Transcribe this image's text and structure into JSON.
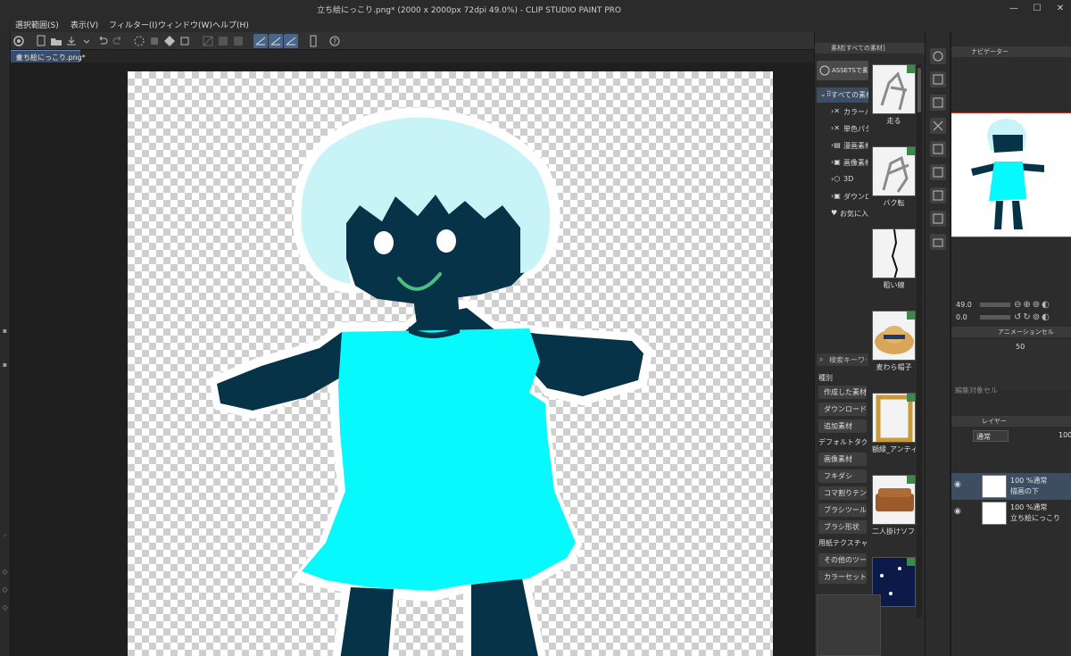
{
  "window": {
    "title": "立ち絵にっこり.png* (2000 x 2000px 72dpi 49.0%)  - CLIP STUDIO PAINT PRO",
    "minimize": "—",
    "maximize": "☐",
    "close": "✕"
  },
  "menu": [
    "選択範囲(S)",
    "表示(V)",
    "フィルター(I)",
    "ウィンドウ(W)",
    "ヘルプ(H)"
  ],
  "document_tab": {
    "label": "立ち絵にっこり.png*",
    "close": "●"
  },
  "materials": {
    "panel_title": "素材[すべての素材]",
    "assets_button": "ASSETSで素材を探す",
    "tree": [
      {
        "label": "すべての素材",
        "icon": "grid-icon"
      },
      {
        "label": "カラーパターン",
        "icon": "cross-icon"
      },
      {
        "label": "単色パターン",
        "icon": "cross-icon"
      },
      {
        "label": "漫画素材",
        "icon": "comic-icon"
      },
      {
        "label": "画像素材",
        "icon": "image-icon"
      },
      {
        "label": "3D",
        "icon": "cube-icon"
      },
      {
        "label": "ダウンロード",
        "icon": "download-icon"
      },
      {
        "label": "お気に入り",
        "icon": "heart-icon"
      }
    ],
    "thumbnails": [
      {
        "caption": "走る"
      },
      {
        "caption": "バク転"
      },
      {
        "caption": "粗い線"
      },
      {
        "caption": "麦わら帽子"
      },
      {
        "caption": "額縁_アンティーク"
      },
      {
        "caption": "二人掛けソファー"
      },
      {
        "caption": ""
      }
    ],
    "search_placeholder": "検索キーワード",
    "kind_label": "種別",
    "kind_buttons": [
      {
        "label": "作成した素材"
      },
      {
        "label": "ダウンロード"
      },
      {
        "label": "追加素材"
      },
      {
        "label": "デフォルトタグ",
        "plain": true
      },
      {
        "label": "画像素材"
      },
      {
        "label": "フキダシ"
      },
      {
        "label": "コマ割りテンプレート"
      },
      {
        "label": "ブラシツール"
      },
      {
        "label": "ブラシ形状"
      },
      {
        "label": "用紙テクスチャ",
        "plain": true
      },
      {
        "label": "その他のツール"
      },
      {
        "label": "カラーセット"
      }
    ]
  },
  "navigator": {
    "tab_label": "ナビゲーター",
    "zoom_value": "49.0",
    "rotate_value": "0.0"
  },
  "animation": {
    "tab_label": "アニメーションセル",
    "value": "50",
    "edit_target": "編集対象セル"
  },
  "layers": {
    "tab_label": "レイヤー",
    "blend_mode": "通常",
    "opacity": "100",
    "rows": [
      {
        "line1": "100 %通常",
        "line2": "描画の下",
        "selected": true
      },
      {
        "line1": "100 %通常",
        "line2": "立ち絵にっこり",
        "selected": false
      }
    ]
  },
  "colors": {
    "skin": "#073349",
    "hair": "#c8f4f8",
    "dress": "#06fafd",
    "mouth": "#4dbf85",
    "accent_selection": "#49658a"
  }
}
